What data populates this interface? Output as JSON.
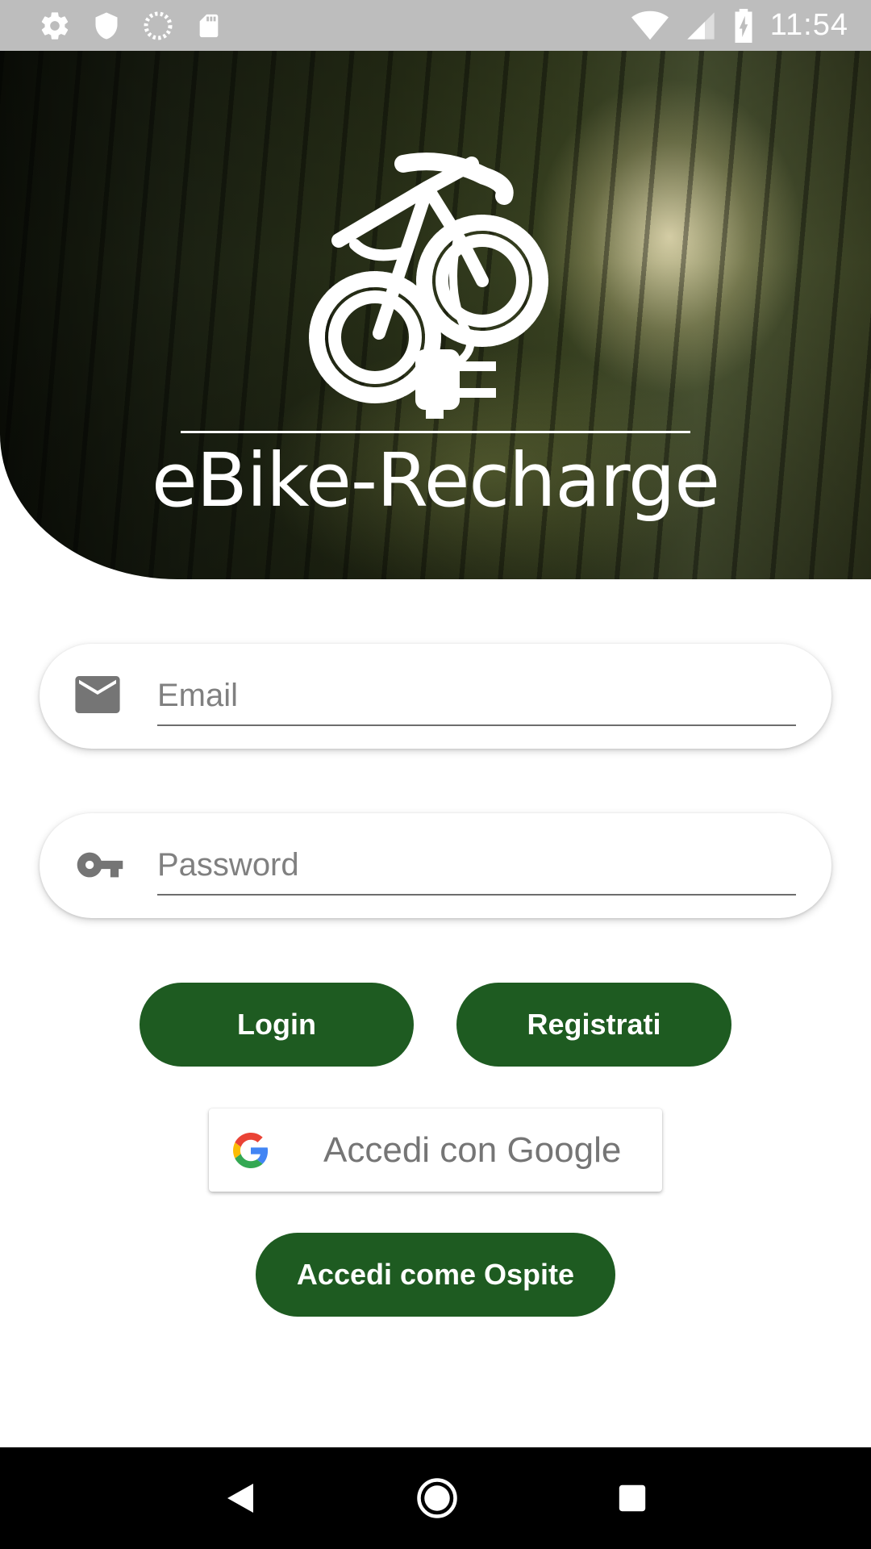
{
  "status_bar": {
    "time": "11:54",
    "left_icons": [
      "gear-icon",
      "shield-icon",
      "sync-icon",
      "sd-card-icon"
    ],
    "right_icons": [
      "wifi-icon",
      "signal-icon",
      "battery-charging-icon"
    ]
  },
  "hero": {
    "title": "eBike-Recharge",
    "logo": "ebike-plug-logo"
  },
  "form": {
    "email": {
      "placeholder": "Email",
      "value": "",
      "icon": "mail-icon"
    },
    "password": {
      "placeholder": "Password",
      "value": "",
      "icon": "key-icon"
    }
  },
  "buttons": {
    "login": "Login",
    "register": "Registrati",
    "google": "Accedi con Google",
    "guest": "Accedi come Ospite"
  },
  "nav_bar": {
    "icons": [
      "back-icon",
      "home-icon",
      "recents-icon"
    ]
  },
  "colors": {
    "primary_green": "#1e5b21",
    "status_bar": "#bdbdbd",
    "nav_bar": "#000000"
  }
}
